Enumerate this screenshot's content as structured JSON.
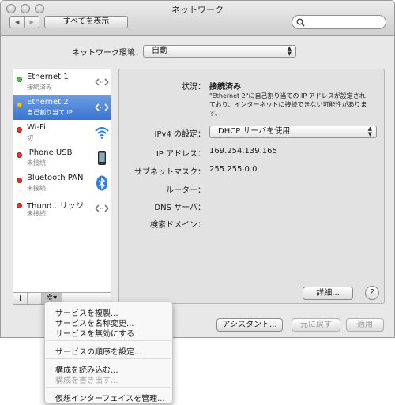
{
  "window": {
    "title": "ネットワーク",
    "show_all_label": "すべてを表示",
    "nav_back": "◀",
    "nav_forward": "▶",
    "search": {
      "placeholder": "",
      "value": ""
    }
  },
  "location": {
    "label": "ネットワーク環境：",
    "value": "自動"
  },
  "services": [
    {
      "name": "Ethernet 1",
      "status": "接続済み",
      "status_color": "#4cc341",
      "icon": "ethernet-icon",
      "selected": false
    },
    {
      "name": "Ethernet 2",
      "status": "自己割り当て IP",
      "status_color": "#f4c227",
      "icon": "ethernet-icon",
      "selected": true
    },
    {
      "name": "Wi-Fi",
      "status": "切",
      "status_color": "#e0342c",
      "icon": "wifi-icon",
      "selected": false
    },
    {
      "name": "iPhone USB",
      "status": "未接続",
      "status_color": "#e0342c",
      "icon": "iphone-icon",
      "selected": false
    },
    {
      "name": "Bluetooth PAN",
      "status": "未接続",
      "status_color": "#e0342c",
      "icon": "bluetooth-icon",
      "selected": false
    },
    {
      "name": "Thund…リッジ",
      "status": "未接続",
      "status_color": "#e0342c",
      "icon": "thunderbolt-bridge-icon",
      "selected": false
    }
  ],
  "bottom_bar": {
    "add": "+",
    "remove": "−",
    "action": "✲▾"
  },
  "detail": {
    "status_label": "状況：",
    "status_value": "接続済み",
    "status_note": "\"Ethernet 2\"に自己割り当ての IP アドレスが設定されており、インターネットに接続できない可能性があります。",
    "ipv4_label": "IPv4 の設定：",
    "ipv4_value": "DHCP サーバを使用",
    "ip_label": "IP アドレス：",
    "ip_value": "169.254.139.165",
    "subnet_label": "サブネットマスク：",
    "subnet_value": "255.255.0.0",
    "router_label": "ルーター：",
    "dns_label": "DNS サーバ：",
    "search_domain_label": "検索ドメイン：",
    "advanced_button": "詳細...",
    "help_button": "?"
  },
  "footer": {
    "assistant_button": "アシスタント...",
    "revert_button": "元に戻す",
    "apply_button": "適用"
  },
  "context_menu": {
    "duplicate": "サービスを複製...",
    "rename": "サービスを名称変更...",
    "deactivate": "サービスを無効にする",
    "set_order": "サービスの順序を設定...",
    "import": "構成を読み込む...",
    "export": "構成を書き出す...",
    "manage_virtual": "仮想インターフェイスを管理..."
  },
  "colors": {
    "selection": "#3b74d1",
    "accent_blue": "#2f7fd8"
  }
}
